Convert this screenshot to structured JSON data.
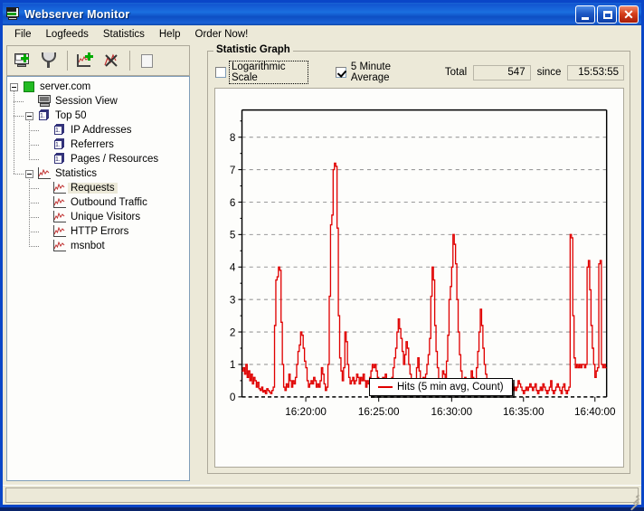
{
  "window": {
    "title": "Webserver Monitor",
    "icon": "server-monitor-icon",
    "buttons": {
      "minimize": "_",
      "maximize": "□",
      "close": "✕"
    }
  },
  "menubar": {
    "items": [
      {
        "label": "File"
      },
      {
        "label": "Logfeeds"
      },
      {
        "label": "Statistics"
      },
      {
        "label": "Help"
      },
      {
        "label": "Order Now!"
      }
    ]
  },
  "toolbar": {
    "buttons": [
      {
        "name": "add-server-icon"
      },
      {
        "name": "remove-server-icon"
      },
      {
        "name": "add-graph-icon"
      },
      {
        "name": "delete-graph-icon"
      },
      {
        "name": "new-page-icon"
      }
    ]
  },
  "tree": {
    "nodes": [
      {
        "label": "server.com",
        "icon": "green-status-icon",
        "depth": 0,
        "expander": true,
        "selected": false
      },
      {
        "label": "Session View",
        "icon": "computer-icon",
        "depth": 1,
        "expander": false,
        "selected": false
      },
      {
        "label": "Top 50",
        "icon": "list-stack-icon",
        "depth": 1,
        "expander": true,
        "selected": false
      },
      {
        "label": "IP Addresses",
        "icon": "list-stack-icon",
        "depth": 2,
        "expander": false,
        "selected": false
      },
      {
        "label": "Referrers",
        "icon": "list-stack-icon",
        "depth": 2,
        "expander": false,
        "selected": false
      },
      {
        "label": "Pages / Resources",
        "icon": "list-stack-icon",
        "depth": 2,
        "expander": false,
        "selected": false
      },
      {
        "label": "Statistics",
        "icon": "graph-icon",
        "depth": 1,
        "expander": true,
        "selected": false
      },
      {
        "label": "Requests",
        "icon": "graph-icon",
        "depth": 2,
        "expander": false,
        "selected": true
      },
      {
        "label": "Outbound Traffic",
        "icon": "graph-icon",
        "depth": 2,
        "expander": false,
        "selected": false
      },
      {
        "label": "Unique Visitors",
        "icon": "graph-icon",
        "depth": 2,
        "expander": false,
        "selected": false
      },
      {
        "label": "HTTP Errors",
        "icon": "graph-icon",
        "depth": 2,
        "expander": false,
        "selected": false
      },
      {
        "label": "msnbot",
        "icon": "graph-icon",
        "depth": 2,
        "expander": false,
        "selected": false
      }
    ]
  },
  "panel": {
    "group_title": "Statistic Graph",
    "log_scale_label": "Logarithmic Scale",
    "log_scale_checked": false,
    "five_min_label": "5 Minute Average",
    "five_min_checked": true,
    "total_label": "Total",
    "total_value": "547",
    "since_label": "since",
    "since_value": "15:53:55"
  },
  "chart_data": {
    "type": "line",
    "title": "",
    "xlabel": "",
    "ylabel": "",
    "legend": "Hits (5 min avg, Count)",
    "legend_position": "bottom-center",
    "grid": true,
    "line_color": "#e00000",
    "ylim": [
      0,
      8.6
    ],
    "yticks": [
      0,
      1,
      2,
      3,
      4,
      5,
      6,
      7,
      8
    ],
    "xticks": [
      "16:20:00",
      "16:25:00",
      "16:30:00",
      "16:35:00",
      "16:40:00"
    ],
    "xtick_positions": [
      0.175,
      0.375,
      0.575,
      0.772,
      0.968
    ],
    "xlim_labels": [
      "16:16:40",
      "16:41:40"
    ],
    "series": [
      {
        "name": "Hits (5 min avg, Count)",
        "values": [
          0.8,
          0.9,
          0.7,
          1.0,
          0.6,
          0.8,
          0.5,
          0.7,
          0.4,
          0.6,
          0.5,
          0.3,
          0.45,
          0.25,
          0.2,
          0.3,
          0.15,
          0.2,
          0.1,
          0.25,
          0.2,
          0.15,
          0.1,
          0.2,
          0.3,
          2.2,
          3.6,
          3.7,
          4.0,
          3.9,
          2.3,
          1.0,
          0.3,
          0.2,
          0.4,
          0.3,
          0.7,
          0.5,
          0.3,
          0.5,
          0.4,
          0.6,
          1.0,
          1.4,
          1.6,
          2.0,
          1.9,
          1.5,
          1.1,
          0.9,
          0.5,
          0.3,
          0.4,
          0.5,
          0.4,
          0.6,
          0.5,
          0.3,
          0.4,
          0.3,
          0.5,
          0.9,
          0.7,
          0.4,
          0.2,
          0.3,
          1.0,
          3.1,
          5.3,
          5.6,
          7.0,
          7.2,
          7.1,
          5.2,
          2.5,
          1.2,
          0.8,
          0.5,
          0.9,
          2.0,
          1.7,
          1.0,
          0.6,
          0.4,
          0.5,
          0.6,
          0.4,
          0.5,
          0.7,
          0.6,
          0.4,
          0.6,
          0.5,
          0.7,
          0.5,
          0.3,
          0.5,
          0.4,
          0.6,
          0.8,
          1.0,
          0.9,
          1.0,
          0.8,
          0.6,
          0.5,
          0.3,
          0.4,
          0.6,
          0.5,
          0.7,
          0.5,
          0.3,
          0.2,
          0.4,
          0.6,
          0.9,
          1.2,
          1.5,
          2.0,
          2.4,
          2.1,
          1.8,
          1.4,
          1.0,
          1.3,
          1.7,
          1.5,
          1.0,
          0.7,
          0.5,
          0.4,
          0.3,
          0.5,
          0.9,
          1.2,
          0.8,
          0.4,
          0.3,
          0.6,
          0.5,
          0.7,
          1.0,
          1.3,
          1.8,
          3.1,
          4.0,
          3.6,
          2.2,
          1.4,
          0.9,
          0.5,
          0.3,
          0.5,
          0.8,
          0.7,
          0.5,
          1.1,
          1.9,
          3.0,
          3.4,
          4.0,
          5.0,
          4.7,
          4.1,
          3.0,
          2.0,
          1.3,
          0.8,
          0.5,
          0.3,
          0.6,
          0.5,
          0.3,
          0.2,
          0.4,
          0.8,
          0.6,
          0.4,
          0.5,
          0.9,
          1.4,
          2.0,
          2.7,
          2.2,
          1.5,
          1.0,
          0.7,
          0.5,
          0.4,
          0.3,
          0.5,
          0.4,
          0.3,
          0.2,
          0.3,
          0.5,
          0.4,
          0.2,
          0.3,
          0.2,
          0.4,
          0.3,
          0.5,
          0.2,
          0.1,
          0.3,
          0.4,
          0.2,
          0.3,
          0.2,
          0.3,
          0.5,
          0.4,
          0.3,
          0.2,
          0.1,
          0.2,
          0.3,
          0.2,
          0.3,
          0.4,
          0.3,
          0.2,
          0.3,
          0.4,
          0.2,
          0.1,
          0.2,
          0.3,
          0.2,
          0.4,
          0.3,
          0.2,
          0.1,
          0.2,
          0.3,
          0.5,
          0.2,
          0.1,
          0.2,
          0.3,
          0.4,
          0.3,
          0.2,
          0.1,
          0.3,
          0.4,
          0.2,
          0.1,
          0.2,
          0.3,
          5.0,
          4.9,
          2.5,
          1.2,
          0.9,
          1.0,
          0.9,
          1.0,
          0.9,
          1.0,
          1.0,
          0.9,
          1.0,
          4.0,
          4.2,
          3.3,
          2.2,
          1.5,
          1.0,
          0.6,
          0.8,
          0.9,
          4.1,
          4.2,
          1.0,
          0.9,
          1.0,
          0.9
        ]
      }
    ]
  },
  "statusbar": {
    "text": ""
  }
}
